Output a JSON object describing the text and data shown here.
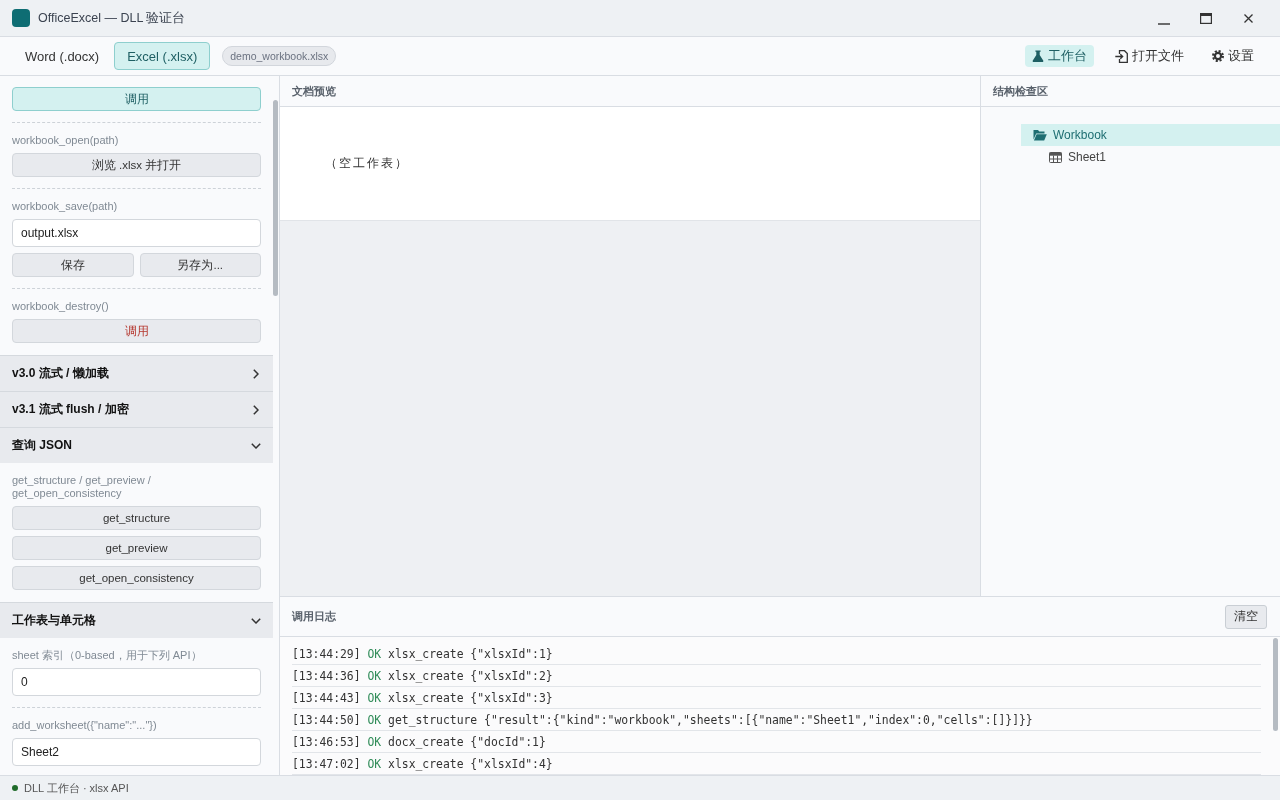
{
  "window": {
    "title": "OfficeExcel — DLL 验证台"
  },
  "tabs": [
    {
      "label": "Word (.docx)",
      "selected": false
    },
    {
      "label": "Excel (.xlsx)",
      "selected": true
    }
  ],
  "file_badge": "demo_workbook.xlsx",
  "nav": [
    {
      "label": "工作台",
      "selected": true
    },
    {
      "label": "打开文件",
      "selected": false
    },
    {
      "label": "设置",
      "selected": false
    }
  ],
  "sidebar": {
    "groups": [
      {
        "controls": [
          {
            "kind": "accent_button",
            "label": "调用"
          }
        ]
      },
      {
        "label": "workbook_open(path)",
        "controls": [
          {
            "kind": "button",
            "label": "浏览 .xlsx 并打开"
          }
        ]
      },
      {
        "label": "workbook_save(path)",
        "controls": [
          {
            "kind": "input",
            "value": "output.xlsx"
          },
          {
            "kind": "button_row",
            "buttons": [
              {
                "kind": "button",
                "label": "保存"
              },
              {
                "kind": "button",
                "label": "另存为..."
              }
            ]
          }
        ]
      },
      {
        "label": "workbook_destroy()",
        "controls": [
          {
            "kind": "danger_button",
            "label": "调用"
          }
        ]
      }
    ],
    "sections": [
      {
        "title": "v3.0 流式 / 懒加载",
        "expanded": false
      },
      {
        "title": "v3.1 流式 flush / 加密",
        "expanded": false
      },
      {
        "title": "查询 JSON",
        "expanded": true,
        "groups": [
          {
            "label": "get_structure / get_preview / get_open_consistency",
            "controls": [
              {
                "kind": "button",
                "label": "get_structure"
              },
              {
                "kind": "button",
                "label": "get_preview"
              },
              {
                "kind": "button",
                "label": "get_open_consistency"
              }
            ]
          }
        ]
      },
      {
        "title": "工作表与单元格",
        "expanded": true,
        "groups": [
          {
            "label": "sheet 索引（0-based，用于下列 API）",
            "controls": [
              {
                "kind": "input",
                "value": "0"
              }
            ]
          },
          {
            "label": "add_worksheet({\"name\":\"...\"})",
            "controls": [
              {
                "kind": "input",
                "value": "Sheet2"
              }
            ]
          }
        ]
      }
    ]
  },
  "preview": {
    "title": "文档预览",
    "empty_text": "（空工作表）"
  },
  "inspector": {
    "title": "结构检查区",
    "tree": [
      {
        "kind": "workbook",
        "label": "Workbook",
        "selected": true,
        "expanded": true,
        "children": [
          {
            "kind": "sheet",
            "label": "Sheet1",
            "selected": false
          }
        ]
      }
    ]
  },
  "log": {
    "title": "调用日志",
    "clear_button": "清空",
    "entries": [
      {
        "time": "[13:44:29]",
        "status": "OK",
        "ok": true,
        "message": "xlsx_create {\"xlsxId\":1}"
      },
      {
        "time": "[13:44:36]",
        "status": "OK",
        "ok": true,
        "message": "xlsx_create {\"xlsxId\":2}"
      },
      {
        "time": "[13:44:43]",
        "status": "OK",
        "ok": true,
        "message": "xlsx_create {\"xlsxId\":3}"
      },
      {
        "time": "[13:44:50]",
        "status": "OK",
        "ok": true,
        "message": "get_structure {\"result\":{\"kind\":\"workbook\",\"sheets\":[{\"name\":\"Sheet1\",\"index\":0,\"cells\":[]}]}}"
      },
      {
        "time": "[13:46:53]",
        "status": "OK",
        "ok": true,
        "message": "docx_create {\"docId\":1}"
      },
      {
        "time": "[13:47:02]",
        "status": "OK",
        "ok": true,
        "message": "xlsx_create {\"xlsxId\":4}"
      }
    ]
  },
  "status_bar": {
    "text": "DLL 工作台 · xlsx API",
    "connected": true
  }
}
